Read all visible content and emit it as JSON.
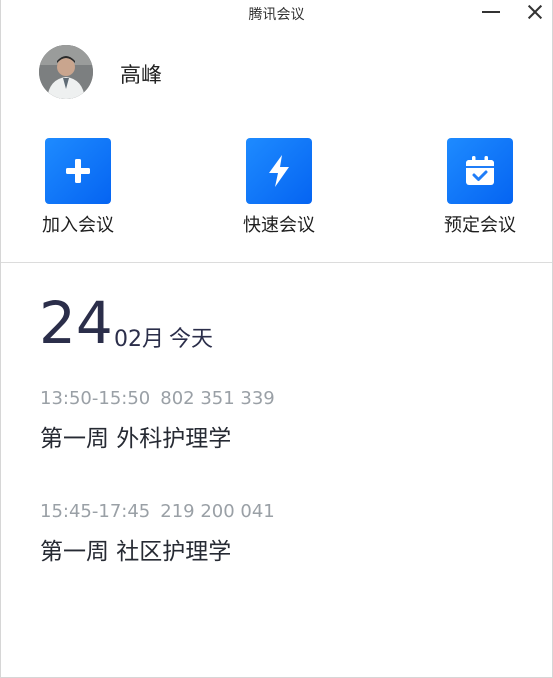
{
  "window": {
    "title": "腾讯会议"
  },
  "user": {
    "name": "高峰"
  },
  "actions": [
    {
      "label": "加入会议",
      "icon": "plus-icon"
    },
    {
      "label": "快速会议",
      "icon": "lightning-icon"
    },
    {
      "label": "预定会议",
      "icon": "calendar-check-icon"
    }
  ],
  "date": {
    "day": "24",
    "month": "02月",
    "today": "今天"
  },
  "meetings": [
    {
      "time": "13:50-15:50",
      "id": "802 351 339",
      "subject": "第一周 外科护理学"
    },
    {
      "time": "15:45-17:45",
      "id": "219 200 041",
      "subject": "第一周 社区护理学"
    }
  ],
  "colors": {
    "accent": "#0a6cf5",
    "text": "#2b2e4a",
    "meta": "#9aa0a6"
  }
}
